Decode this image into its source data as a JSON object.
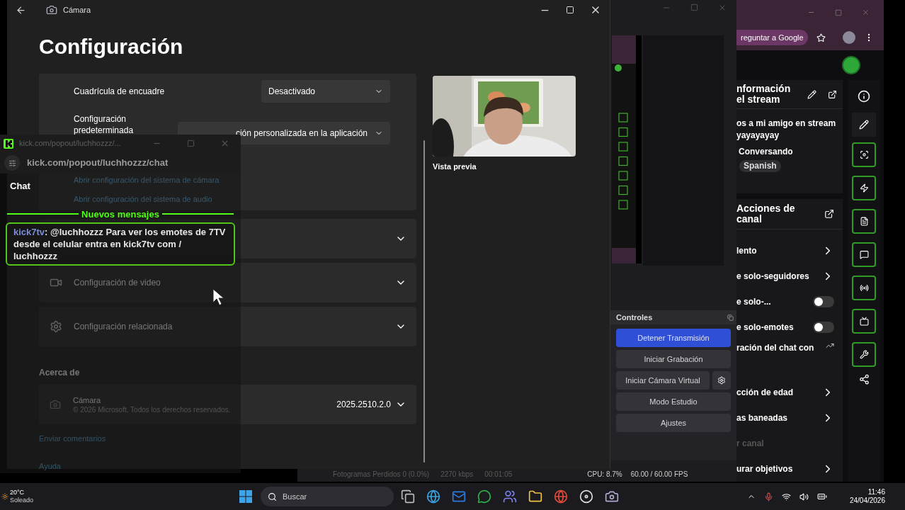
{
  "camera_window": {
    "title": "Cámara",
    "heading": "Configuración",
    "settings": [
      {
        "label": "Cuadrícula de encuadre",
        "value": "Desactivado"
      },
      {
        "label": "Configuración predeterminada",
        "value": "ción personalizada en la aplicación"
      }
    ],
    "links": [
      "Abrir configuración del sistema de cámara",
      "Abrir configuración del sistema de audio"
    ],
    "sections": [
      {
        "kind": "audio"
      },
      {
        "kind": "video",
        "label": "Configuración de video"
      },
      {
        "kind": "related",
        "label": "Configuración relacionada"
      }
    ],
    "about": {
      "heading": "Acerca de",
      "app_name": "Cámara",
      "copyright": "© 2026 Microsoft. Todos los derechos reservados.",
      "version": "2025.2510.2.0"
    },
    "footer_links": [
      "Enviar comentarios",
      "Ayuda"
    ],
    "preview": {
      "kind": "picture",
      "caption": "Vista previa"
    }
  },
  "chat_popup": {
    "title": "kick.com/popout/luchhozzz/...",
    "url": "kick.com/popout/luchhozzz/chat",
    "heading": "Chat",
    "divider": "Nuevos mensajes",
    "messages": [
      {
        "user": "kick7tv",
        "text": ": @luchhozzz Para ver los emotes de 7TV desde el celular entra en kick7tv com / luchhozzz",
        "highlighted": true
      }
    ]
  },
  "obs_window": {
    "controls": {
      "title": "Controles",
      "buttons": [
        {
          "label": "Detener Transmisión",
          "active": true,
          "has_settings": false
        },
        {
          "label": "Iniciar Grabación",
          "active": false,
          "has_settings": false
        },
        {
          "label": "Iniciar Cámara Virtual",
          "active": false,
          "has_settings": true
        },
        {
          "label": "Modo Estudio",
          "active": false,
          "has_settings": false
        },
        {
          "label": "Ajustes",
          "active": false,
          "has_settings": false
        }
      ]
    },
    "status": [
      "Fotogramas Perdidos 0 (0.0%)",
      "2270 kbps",
      "00:01:05",
      "CPU: 8.7%",
      "60.00 / 60.00 FPS"
    ]
  },
  "browser": {
    "ask_button": "reguntar a Google",
    "stream_info": {
      "title_lines": [
        "nformación",
        "el stream"
      ],
      "lines": [
        "os a mi amigo en stream",
        "yayayayay"
      ],
      "category": "Conversando",
      "tag": "Spanish"
    },
    "actions": {
      "title_lines": [
        "Acciones de",
        "canal"
      ],
      "items": [
        {
          "kind": "link",
          "label": "lento"
        },
        {
          "kind": "link",
          "label": "e solo-seguidores"
        },
        {
          "kind": "toggle",
          "label": "e solo-...",
          "on": false
        },
        {
          "kind": "toggle",
          "label": "e solo-emotes",
          "on": false
        },
        {
          "kind": "external",
          "label": "ración del chat con"
        },
        {
          "kind": "link",
          "label": "cción de edad"
        },
        {
          "kind": "link",
          "label": "as baneadas"
        },
        {
          "kind": "disabled",
          "label": "r canal"
        },
        {
          "kind": "link",
          "label": "urar objetivos"
        }
      ]
    }
  },
  "taskbar": {
    "weather": {
      "temp": "20°C",
      "condition": "Soleado"
    },
    "search_placeholder": "Buscar",
    "time": "11:46",
    "date": "24/04/2026"
  }
}
